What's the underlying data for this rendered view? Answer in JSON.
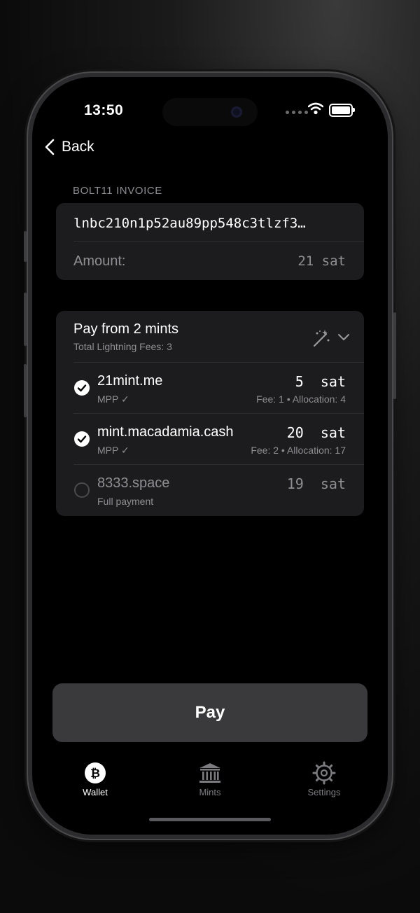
{
  "status": {
    "time": "13:50"
  },
  "nav": {
    "back_label": "Back"
  },
  "invoice": {
    "section_label": "BOLT11 INVOICE",
    "text": "lnbc210n1p52au89pp548c3tlzf3…",
    "amount_label": "Amount:",
    "amount_value": "21 sat"
  },
  "payment": {
    "title": "Pay from 2 mints",
    "subtitle": "Total Lightning Fees: 3",
    "mints": [
      {
        "name": "21mint.me",
        "mode": "MPP ✓",
        "amount": "5  sat",
        "details": "Fee: 1 • Allocation: 4",
        "selected": true
      },
      {
        "name": "mint.macadamia.cash",
        "mode": "MPP ✓",
        "amount": "20  sat",
        "details": "Fee: 2 • Allocation: 17",
        "selected": true
      },
      {
        "name": "8333.space",
        "mode": "Full payment",
        "amount": "19  sat",
        "details": "",
        "selected": false
      }
    ]
  },
  "actions": {
    "pay_label": "Pay"
  },
  "tabs": [
    {
      "label": "Wallet",
      "icon": "bitcoin-icon",
      "active": true
    },
    {
      "label": "Mints",
      "icon": "bank-icon",
      "active": false
    },
    {
      "label": "Settings",
      "icon": "gear-icon",
      "active": false
    }
  ],
  "colors": {
    "background": "#000000",
    "card": "#1c1c1e",
    "secondary_text": "#8e8e93",
    "button": "#3a3a3c"
  }
}
